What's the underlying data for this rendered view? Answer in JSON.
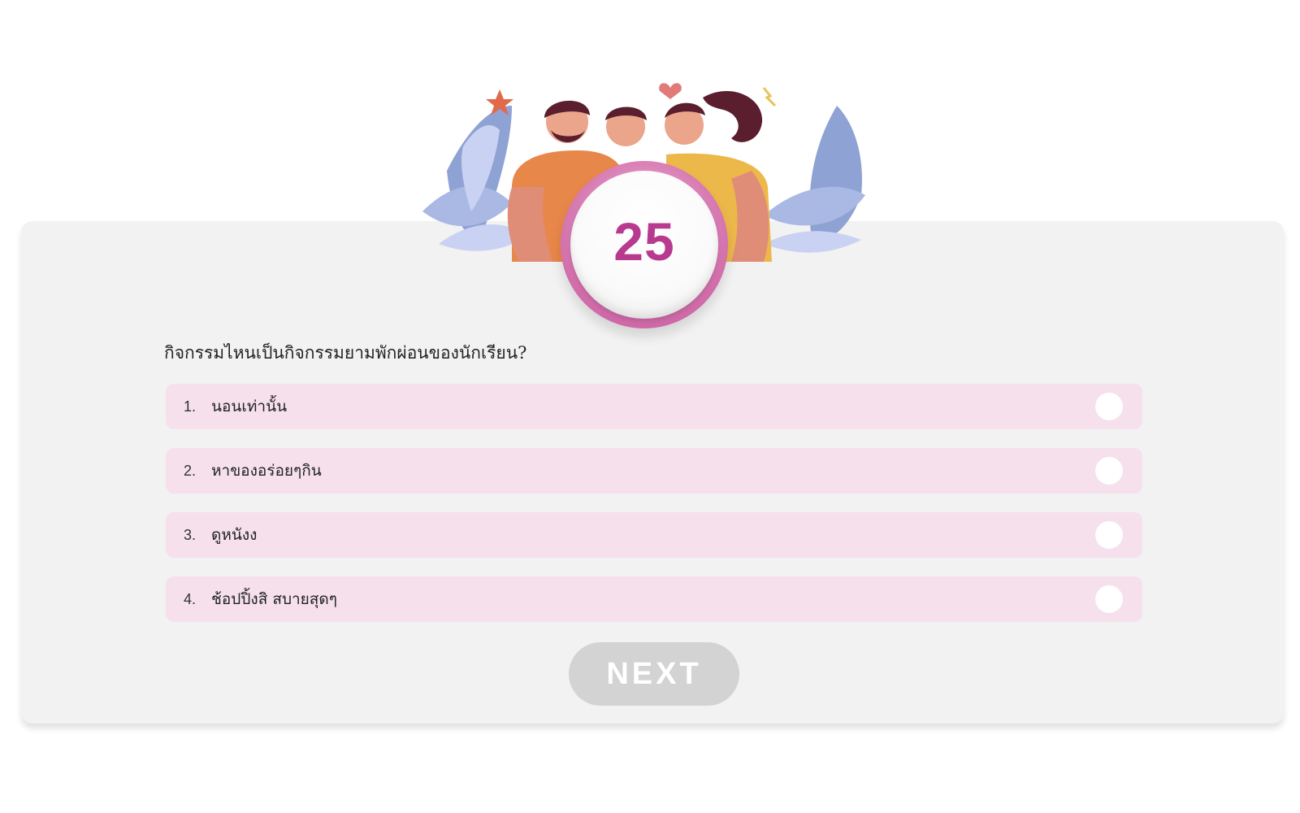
{
  "timer": {
    "value": "25"
  },
  "question": {
    "text": "กิจกรรมไหนเป็นกิจกรรมยามพักผ่อนของนักเรียน?"
  },
  "options": [
    {
      "number": "1.",
      "label": "นอนเท่านั้น"
    },
    {
      "number": "2.",
      "label": "หาของอร่อยๆกิน"
    },
    {
      "number": "3.",
      "label": "ดูหนังง"
    },
    {
      "number": "4.",
      "label": "ช้อปปิ้งสิ สบายสุดๆ"
    }
  ],
  "next_button": {
    "label": "NEXT"
  },
  "colors": {
    "accent": "#b73a8f",
    "option_bg": "#f5e0ec",
    "card_bg": "#f2f2f2",
    "button_disabled": "#d3d3d3"
  },
  "illustration": {
    "icon": "friends-group-illustration"
  }
}
